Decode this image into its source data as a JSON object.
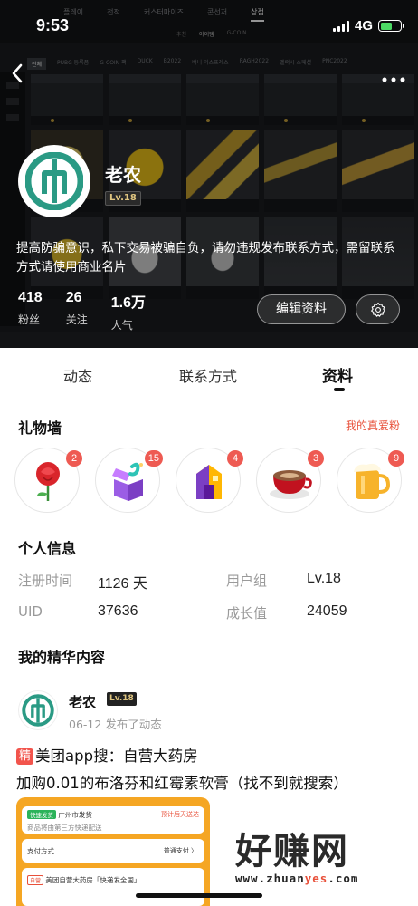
{
  "status_bar": {
    "time": "9:53",
    "network": "4G"
  },
  "background_game": {
    "top_tabs": [
      "플레이",
      "전적",
      "커스터마이즈",
      "콘선처",
      "상점"
    ],
    "active_top_tab": "상점",
    "sub_tabs": [
      "추천",
      "아이템",
      "G-COIN"
    ],
    "categories": [
      "전체",
      "PUBG 등록품",
      "G-COIN 팩",
      "DUCK",
      "B2022",
      "버니 익스프레스",
      "RAGH2022",
      "멜럭시 스페셜",
      "PNC2022"
    ]
  },
  "profile": {
    "name": "老农",
    "level": "Lv.18",
    "bio": "提高防骗意识，私下交易被骗自负，请勿违规发布联系方式，需留联系方式请使用商业名片",
    "stats": [
      {
        "value": "418",
        "label": "粉丝"
      },
      {
        "value": "26",
        "label": "关注"
      },
      {
        "value": "1.6万",
        "label": "人气"
      }
    ],
    "edit_button": "编辑资料"
  },
  "tabs": [
    "动态",
    "联系方式",
    "资料"
  ],
  "active_tab": "资料",
  "gift_wall": {
    "title": "礼物墙",
    "link": "我的真爱粉",
    "gifts": [
      {
        "icon": "rose-icon",
        "count": "2"
      },
      {
        "icon": "gift-box-icon",
        "count": "15"
      },
      {
        "icon": "castle-icon",
        "count": "4"
      },
      {
        "icon": "coffee-cup-icon",
        "count": "3"
      },
      {
        "icon": "beer-mug-icon",
        "count": "9"
      }
    ]
  },
  "personal_info": {
    "title": "个人信息",
    "fields": [
      {
        "label": "注册时间",
        "value": "1126 天"
      },
      {
        "label": "用户组",
        "value": "Lv.18"
      },
      {
        "label": "UID",
        "value": "37636"
      },
      {
        "label": "成长值",
        "value": "24059"
      }
    ]
  },
  "featured": {
    "title": "我的精华内容",
    "post": {
      "author": "老农",
      "level": "Lv.18",
      "meta": "06-12 发布了动态",
      "tag": "精",
      "line1": "美团app搜：自营大药房",
      "line2": "加购0.01的布洛芬和红霉素软膏（找不到就搜索）",
      "screenshot": {
        "ship_tag": "快速发货",
        "ship_from": "广州市发货",
        "ship_right": "预计后天送达",
        "ship_note": "商品将由第三方快递配送",
        "pay_label": "支付方式",
        "pay_value": "普通支付 〉",
        "store_tag": "自营",
        "store_name": "美团自营大药房「快递发全国」"
      }
    }
  },
  "watermark": {
    "brand": "好赚网",
    "url_prefix": "www.zhuan",
    "url_highlight": "yes",
    "url_suffix": ".com"
  }
}
